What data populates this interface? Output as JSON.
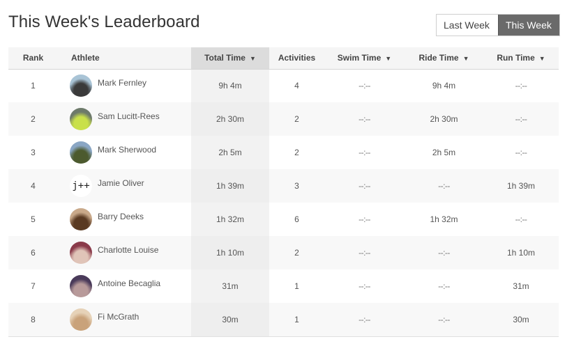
{
  "page": {
    "title": "This Week's Leaderboard"
  },
  "period_toggle": {
    "options": [
      "Last Week",
      "This Week"
    ],
    "selected": "This Week"
  },
  "table": {
    "columns": [
      {
        "key": "rank",
        "label": "Rank",
        "sortable": false
      },
      {
        "key": "athlete",
        "label": "Athlete",
        "sortable": false
      },
      {
        "key": "total_time",
        "label": "Total Time",
        "sortable": true,
        "sorted": true
      },
      {
        "key": "activities",
        "label": "Activities",
        "sortable": false
      },
      {
        "key": "swim_time",
        "label": "Swim Time",
        "sortable": true
      },
      {
        "key": "ride_time",
        "label": "Ride Time",
        "sortable": true
      },
      {
        "key": "run_time",
        "label": "Run Time",
        "sortable": true
      }
    ],
    "sort_icon": "▼",
    "rows": [
      {
        "rank": "1",
        "name": "Mark Fernley",
        "avatar": {
          "type": "photo",
          "colors": [
            "#a9c4d6",
            "#3a3a3a"
          ]
        },
        "total_time": "9h 4m",
        "activities": "4",
        "swim_time": "--:--",
        "ride_time": "9h 4m",
        "run_time": "--:--"
      },
      {
        "rank": "2",
        "name": "Sam Lucitt-Rees",
        "avatar": {
          "type": "photo",
          "colors": [
            "#6d7a6a",
            "#c9e04a"
          ]
        },
        "total_time": "2h 30m",
        "activities": "2",
        "swim_time": "--:--",
        "ride_time": "2h 30m",
        "run_time": "--:--"
      },
      {
        "rank": "3",
        "name": "Mark Sherwood",
        "avatar": {
          "type": "photo",
          "colors": [
            "#8aa6c4",
            "#4c5a2e"
          ]
        },
        "total_time": "2h 5m",
        "activities": "2",
        "swim_time": "--:--",
        "ride_time": "2h 5m",
        "run_time": "--:--"
      },
      {
        "rank": "4",
        "name": "Jamie Oliver",
        "avatar": {
          "type": "text",
          "text": "j++"
        },
        "total_time": "1h 39m",
        "activities": "3",
        "swim_time": "--:--",
        "ride_time": "--:--",
        "run_time": "1h 39m"
      },
      {
        "rank": "5",
        "name": "Barry Deeks",
        "avatar": {
          "type": "photo",
          "colors": [
            "#c9a98a",
            "#5a3a22"
          ]
        },
        "total_time": "1h 32m",
        "activities": "6",
        "swim_time": "--:--",
        "ride_time": "1h 32m",
        "run_time": "--:--"
      },
      {
        "rank": "6",
        "name": "Charlotte Louise",
        "avatar": {
          "type": "photo",
          "colors": [
            "#8a3a4a",
            "#e0c4b8"
          ]
        },
        "total_time": "1h 10m",
        "activities": "2",
        "swim_time": "--:--",
        "ride_time": "--:--",
        "run_time": "1h 10m"
      },
      {
        "rank": "7",
        "name": "Antoine Becaglia",
        "avatar": {
          "type": "photo",
          "colors": [
            "#4a3a5a",
            "#b89a9a"
          ]
        },
        "total_time": "31m",
        "activities": "1",
        "swim_time": "--:--",
        "ride_time": "--:--",
        "run_time": "31m"
      },
      {
        "rank": "8",
        "name": "Fi McGrath",
        "avatar": {
          "type": "photo",
          "colors": [
            "#e6d2b8",
            "#c9a27a"
          ]
        },
        "total_time": "30m",
        "activities": "1",
        "swim_time": "--:--",
        "ride_time": "--:--",
        "run_time": "30m"
      }
    ]
  }
}
